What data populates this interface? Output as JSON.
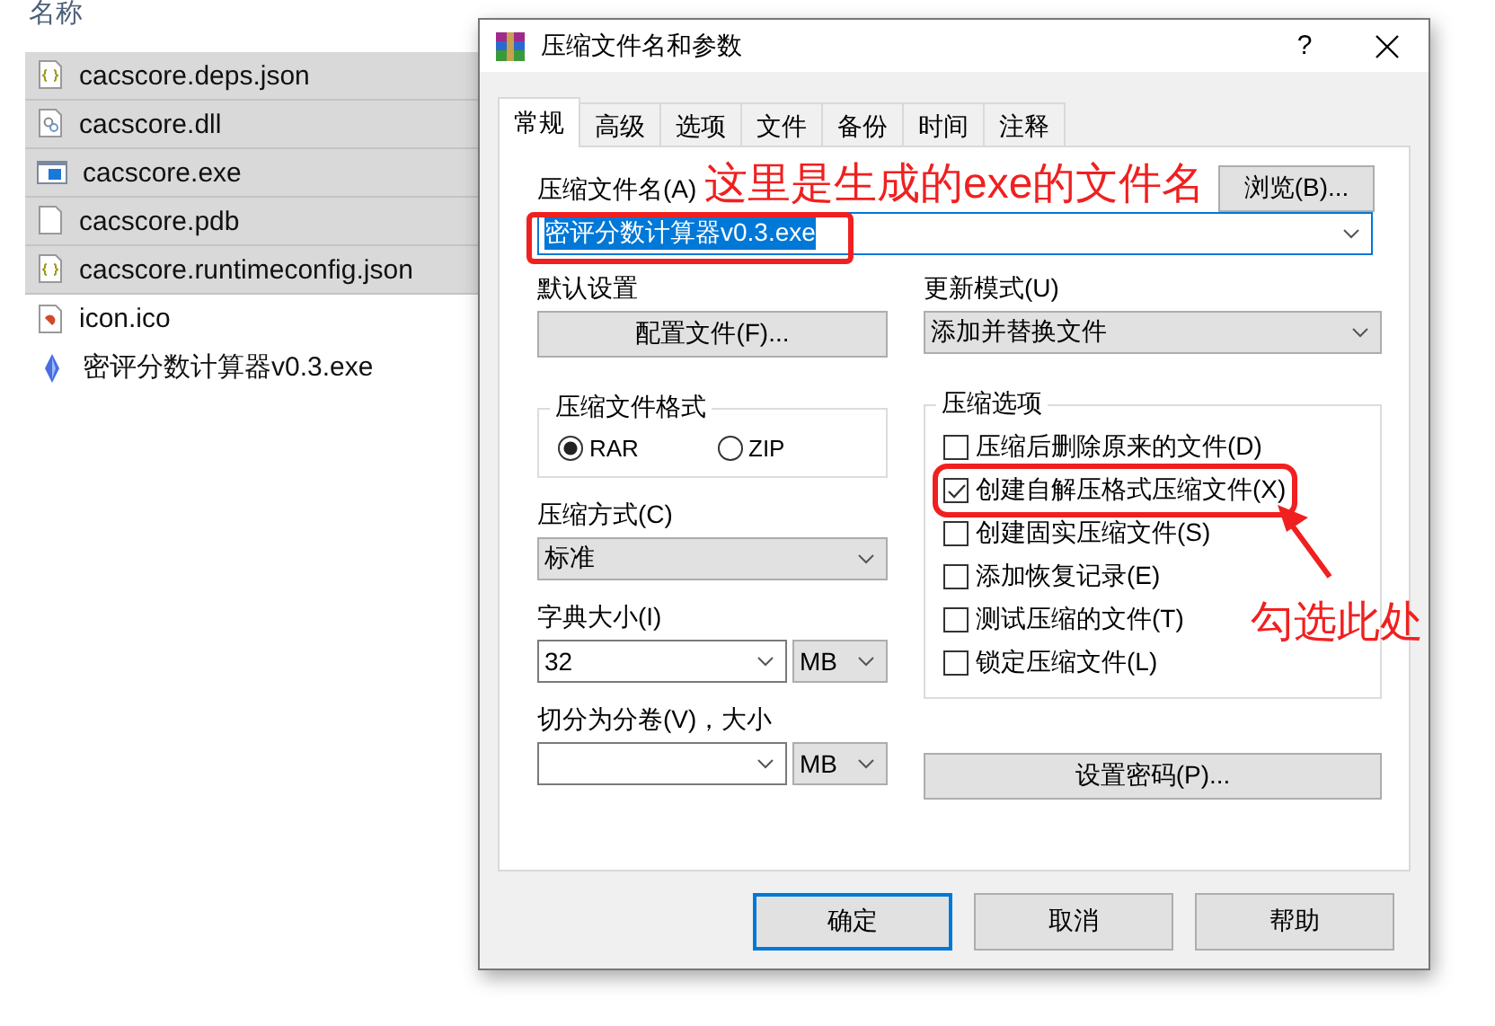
{
  "file_list": {
    "header": "名称",
    "files": [
      {
        "name": "cacscore.deps.json",
        "kind": "json",
        "selected": true
      },
      {
        "name": "cacscore.dll",
        "kind": "dll",
        "selected": true
      },
      {
        "name": "cacscore.exe",
        "kind": "exe",
        "selected": true
      },
      {
        "name": "cacscore.pdb",
        "kind": "blank",
        "selected": true
      },
      {
        "name": "cacscore.runtimeconfig.json",
        "kind": "json",
        "selected": true
      },
      {
        "name": "icon.ico",
        "kind": "ico",
        "selected": false
      },
      {
        "name": "密评分数计算器v0.3.exe",
        "kind": "app",
        "selected": false
      }
    ]
  },
  "dialog": {
    "title": "压缩文件名和参数",
    "help": "?",
    "tabs": [
      {
        "label": "常规",
        "selected": true
      },
      {
        "label": "高级",
        "selected": false
      },
      {
        "label": "选项",
        "selected": false
      },
      {
        "label": "文件",
        "selected": false
      },
      {
        "label": "备份",
        "selected": false
      },
      {
        "label": "时间",
        "selected": false
      },
      {
        "label": "注释",
        "selected": false
      }
    ],
    "archive_name": {
      "label": "压缩文件名(A)",
      "value": "密评分数计算器v0.3.exe",
      "highlighted": true,
      "browse": "浏览(B)..."
    },
    "profiles": {
      "label": "默认设置",
      "button": "配置文件(F)..."
    },
    "update_mode": {
      "label": "更新模式(U)",
      "value": "添加并替换文件"
    },
    "format": {
      "title": "压缩文件格式",
      "options": [
        {
          "label": "RAR",
          "selected": true
        },
        {
          "label": "ZIP",
          "selected": false
        }
      ]
    },
    "method": {
      "label": "压缩方式(C)",
      "value": "标准"
    },
    "dictionary": {
      "label": "字典大小(I)",
      "value": "32",
      "unit": "MB"
    },
    "split": {
      "label": "切分为分卷(V)，大小",
      "unit": "MB"
    },
    "options": {
      "title": "压缩选项",
      "items": [
        {
          "label": "压缩后删除原来的文件(D)",
          "checked": false,
          "annotated": false
        },
        {
          "label": "创建自解压格式压缩文件(X)",
          "checked": true,
          "annotated": true
        },
        {
          "label": "创建固实压缩文件(S)",
          "checked": false,
          "annotated": false
        },
        {
          "label": "添加恢复记录(E)",
          "checked": false,
          "annotated": false
        },
        {
          "label": "测试压缩的文件(T)",
          "checked": false,
          "annotated": false
        },
        {
          "label": "锁定压缩文件(L)",
          "checked": false,
          "annotated": false
        }
      ]
    },
    "password": "设置密码(P)...",
    "buttons": [
      {
        "label": "确定",
        "default": true
      },
      {
        "label": "取消",
        "default": false
      },
      {
        "label": "帮助",
        "default": false
      }
    ]
  },
  "annotations": {
    "filename_note": "这里是生成的exe的文件名",
    "checkbox_note": "勾选此处"
  }
}
